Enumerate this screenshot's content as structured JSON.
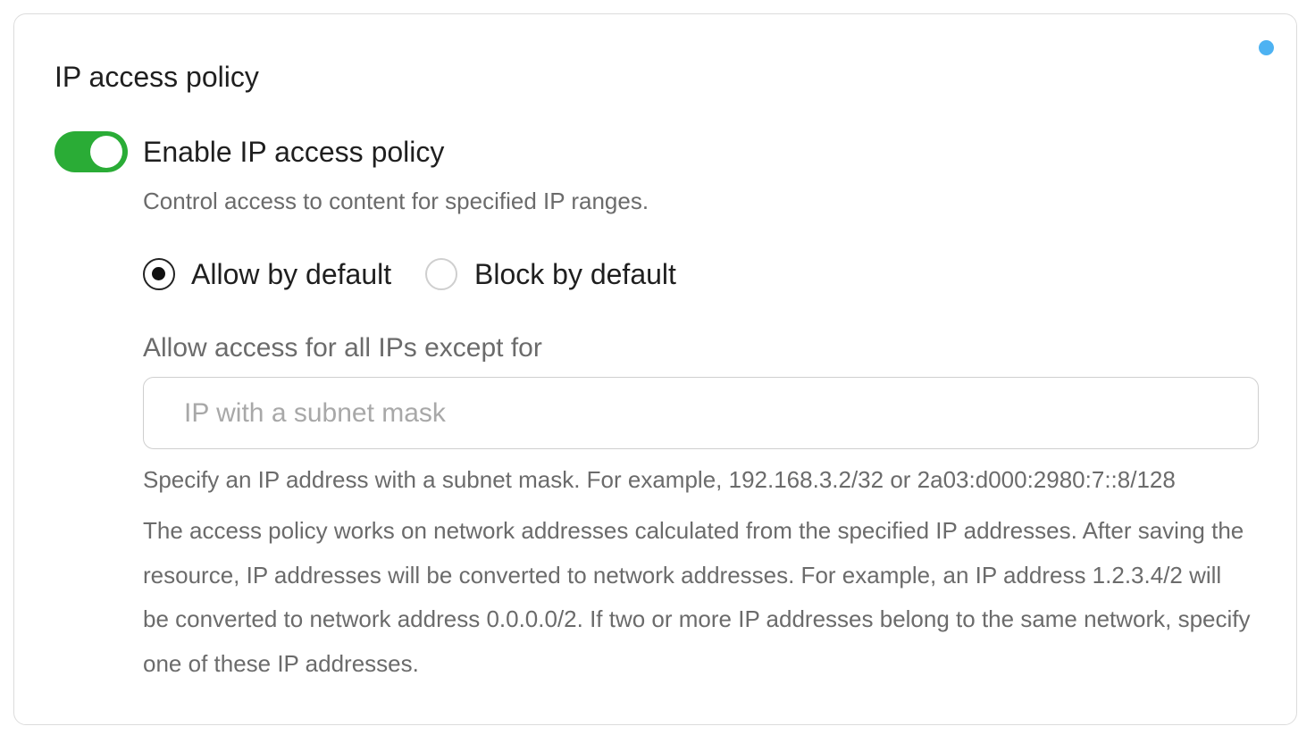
{
  "card": {
    "title": "IP access policy",
    "status_dot_color": "#4db2f2"
  },
  "toggle": {
    "label": "Enable IP access policy",
    "description": "Control access to content for specified IP ranges.",
    "enabled": true,
    "color": "#2aac36"
  },
  "default_mode": {
    "options": [
      {
        "label": "Allow by default",
        "selected": true
      },
      {
        "label": "Block by default",
        "selected": false
      }
    ]
  },
  "exceptions": {
    "label": "Allow access for all IPs except for",
    "input_value": "",
    "placeholder": "IP with a subnet mask",
    "hint": "Specify an IP address with a subnet mask. For example, 192.168.3.2/32 or 2a03:d000:2980:7::8/128",
    "note": "The access policy works on network addresses calculated from the specified IP addresses. After saving the resource, IP addresses will be converted to network addresses. For example, an IP address 1.2.3.4/2 will be converted to network address 0.0.0.0/2. If two or more IP addresses belong to the same network, specify one of these IP addresses."
  }
}
